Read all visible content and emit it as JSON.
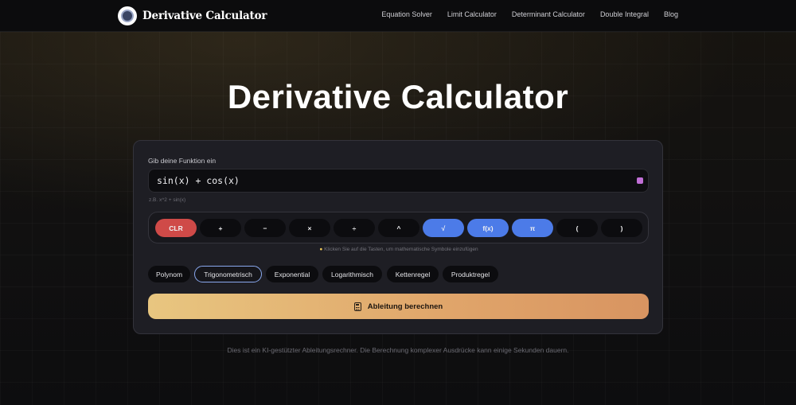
{
  "brand": {
    "name": "Derivative Calculator",
    "logo_icon": "logo-icon"
  },
  "nav": {
    "links": [
      "Equation Solver",
      "Limit Calculator",
      "Determinant Calculator",
      "Double Integral",
      "Blog"
    ]
  },
  "hero": {
    "title": "Derivative Calculator"
  },
  "form": {
    "label": "Gib deine Funktion ein",
    "input_value": "sin(x) + cos(x)",
    "input_hint": "z.B. x^2 + sin(x)",
    "keypad": [
      "CLR",
      "+",
      "−",
      "×",
      "÷",
      "^",
      "√",
      "f(x)",
      "π",
      "(",
      ")"
    ],
    "keypad_hint": "Klicken Sie auf die Tasten, um mathematische Symbole einzufügen",
    "examples": [
      "Polynom",
      "Trigonometrisch",
      "Exponential",
      "Logarithmisch",
      "Kettenregel",
      "Produktregel"
    ],
    "active_example": "Trigonometrisch",
    "submit_label": "Ableitung berechnen"
  },
  "footer": {
    "disclaimer": "Dies ist ein KI-gestützter Ableitungsrechner. Die Berechnung komplexer Ausdrücke kann einige Sekunden dauern."
  },
  "colors": {
    "accent_gold": "#e8c680",
    "accent_orange": "#d89461",
    "key_blue": "#4c7be8",
    "key_red": "#cf4a48"
  }
}
